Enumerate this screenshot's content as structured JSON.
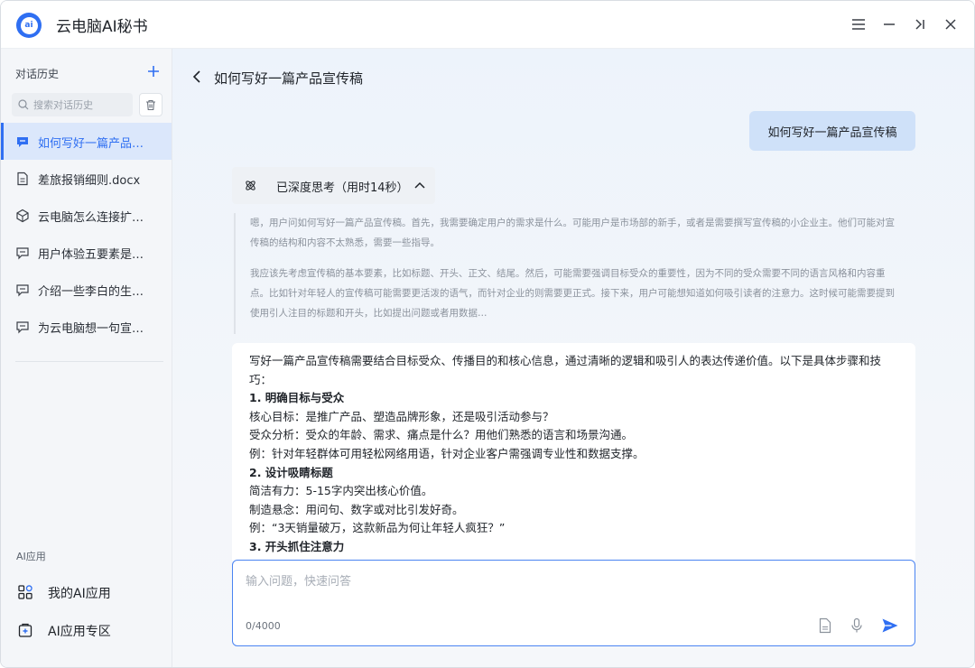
{
  "app": {
    "title": "云电脑AI秘书",
    "logo_text": "ai"
  },
  "sidebar": {
    "history_heading": "对话历史",
    "search_placeholder": "搜索对话历史",
    "items": [
      {
        "label": "如何写好一篇产品…",
        "icon": "chat-icon",
        "active": true
      },
      {
        "label": "差旅报销细则.docx",
        "icon": "document-icon",
        "active": false
      },
      {
        "label": "云电脑怎么连接扩…",
        "icon": "cube-icon",
        "active": false
      },
      {
        "label": "用户体验五要素是…",
        "icon": "chat-icon",
        "active": false
      },
      {
        "label": "介绍一些李白的生…",
        "icon": "chat-icon",
        "active": false
      },
      {
        "label": "为云电脑想一句宣…",
        "icon": "chat-icon",
        "active": false
      }
    ],
    "ai_heading": "AI应用",
    "ai_items": [
      {
        "label": "我的AI应用",
        "icon": "apps-grid-icon"
      },
      {
        "label": "AI应用专区",
        "icon": "app-store-icon"
      }
    ]
  },
  "chat": {
    "title": "如何写好一篇产品宣传稿",
    "user_message": "如何写好一篇产品宣传稿",
    "think_label": "已深度思考（用时14秒）",
    "think_paragraphs": [
      "嗯，用户问如何写好一篇产品宣传稿。首先，我需要确定用户的需求是什么。可能用户是市场部的新手，或者是需要撰写宣传稿的小企业主。他们可能对宣传稿的结构和内容不太熟悉，需要一些指导。",
      "我应该先考虑宣传稿的基本要素，比如标题、开头、正文、结尾。然后，可能需要强调目标受众的重要性，因为不同的受众需要不同的语言风格和内容重点。比如针对年轻人的宣传稿可能需要更活泼的语气，而针对企业的则需要更正式。接下来，用户可能想知道如何吸引读者的注意力。这时候可能需要提到使用引人注目的标题和开头，比如提出问题或者用数据…"
    ],
    "answer_lines": [
      {
        "text": "写好一篇产品宣传稿需要结合目标受众、传播目的和核心信息，通过清晰的逻辑和吸引人的表达传递价值。以下是具体步骤和技巧：",
        "heading": false
      },
      {
        "text": "1. 明确目标与受众",
        "heading": true
      },
      {
        "text": "核心目标：是推广产品、塑造品牌形象，还是吸引活动参与？",
        "heading": false
      },
      {
        "text": "受众分析：受众的年龄、需求、痛点是什么？用他们熟悉的语言和场景沟通。",
        "heading": false
      },
      {
        "text": "例：针对年轻群体可用轻松网络用语，针对企业客户需强调专业性和数据支撑。",
        "heading": false
      },
      {
        "text": "2. 设计吸睛标题",
        "heading": true
      },
      {
        "text": "简洁有力：5-15字内突出核心价值。",
        "heading": false
      },
      {
        "text": "制造悬念：用问句、数字或对比引发好奇。",
        "heading": false
      },
      {
        "text": "例：“3天销量破万，这款新品为何让年轻人疯狂？”",
        "heading": false
      },
      {
        "text": "3. 开头抓住注意力",
        "heading": true
      }
    ],
    "input_placeholder": "输入问题，快速问答",
    "input_value": "",
    "counter": "0/4000"
  },
  "colors": {
    "accent": "#2f6ff2",
    "user_bubble": "#cfe1f9",
    "sidebar_bg": "#f4f6f9"
  }
}
